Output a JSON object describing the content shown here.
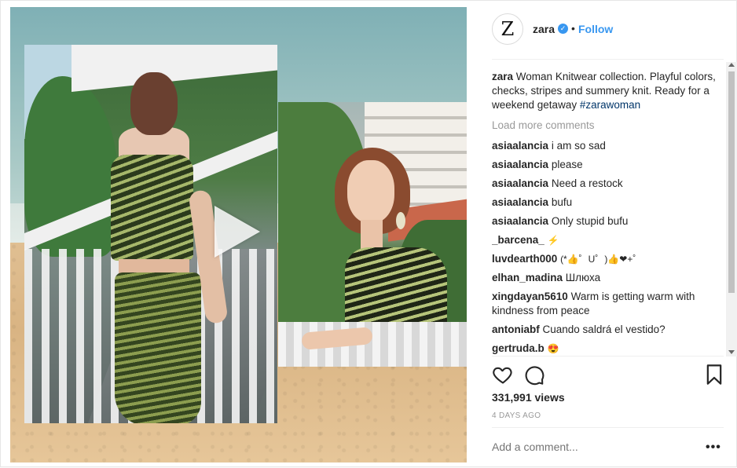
{
  "header": {
    "avatar_letter": "Z",
    "username": "zara",
    "verified_mark": "✓",
    "separator": "•",
    "follow_label": "Follow"
  },
  "caption": {
    "username": "zara",
    "text": "Woman Knitwear collection. Playful colors, checks, stripes and summery knit. Ready for a weekend getaway",
    "hashtag": "#zarawoman"
  },
  "load_more_label": "Load more comments",
  "comments": [
    {
      "user": "asiaalancia",
      "text": "i am so sad"
    },
    {
      "user": "asiaalancia",
      "text": "please"
    },
    {
      "user": "asiaalancia",
      "text": "Need a restock"
    },
    {
      "user": "asiaalancia",
      "text": "bufu"
    },
    {
      "user": "asiaalancia",
      "text": "Only stupid bufu"
    },
    {
      "user": "_barcena_",
      "text": "⚡"
    },
    {
      "user": "luvdearth000",
      "text": "(*👍゜U゜)👍❤+゜"
    },
    {
      "user": "elhan_madina",
      "text": "Шлюха"
    },
    {
      "user": "xingdayan5610",
      "text": "Warm is getting warm with kindness from peace"
    },
    {
      "user": "antoniabf",
      "text": "Cuando saldrá el vestido?"
    },
    {
      "user": "gertruda.b",
      "text": "😍"
    }
  ],
  "stats": {
    "views": "331,991 views",
    "time_ago": "4 DAYS AGO"
  },
  "add_comment_placeholder": "Add a comment...",
  "more_label": "•••",
  "icons": {
    "like": "heart-icon",
    "comment": "comment-icon",
    "save": "bookmark-icon",
    "play": "play-icon"
  },
  "colors": {
    "accent": "#3897f0",
    "muted": "#999999",
    "text": "#262626",
    "hashtag": "#003569"
  }
}
